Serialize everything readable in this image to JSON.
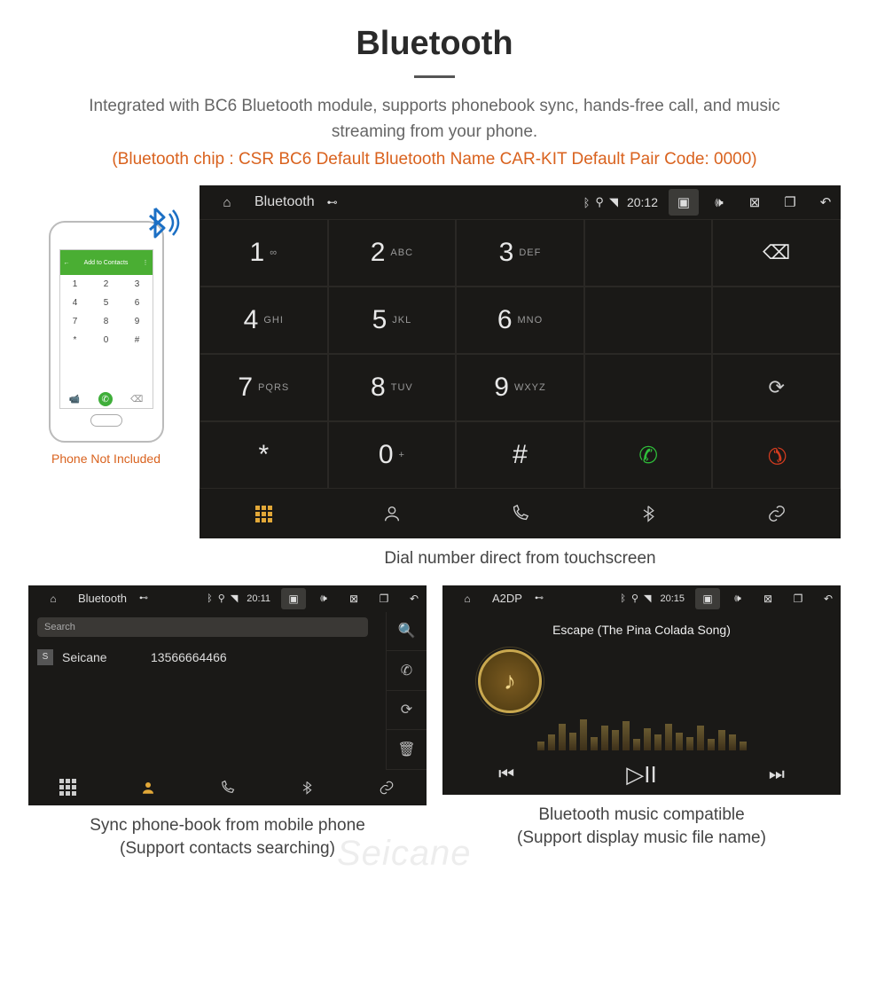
{
  "header": {
    "title": "Bluetooth",
    "desc": "Integrated with BC6 Bluetooth module, supports phonebook sync, hands-free call, and music streaming from your phone.",
    "spec": "(Bluetooth chip : CSR BC6     Default Bluetooth Name CAR-KIT     Default Pair Code: 0000)"
  },
  "phone": {
    "topbar": "Add to Contacts",
    "keys": [
      "1",
      "2",
      "3",
      "4",
      "5",
      "6",
      "7",
      "8",
      "9",
      "*",
      "0",
      "#"
    ],
    "note": "Phone Not Included"
  },
  "dialer": {
    "status": {
      "title": "Bluetooth",
      "time": "20:12"
    },
    "keys": [
      {
        "d": "1",
        "s": "∞"
      },
      {
        "d": "2",
        "s": "ABC"
      },
      {
        "d": "3",
        "s": "DEF"
      },
      {
        "d": "4",
        "s": "GHI"
      },
      {
        "d": "5",
        "s": "JKL"
      },
      {
        "d": "6",
        "s": "MNO"
      },
      {
        "d": "7",
        "s": "PQRS"
      },
      {
        "d": "8",
        "s": "TUV"
      },
      {
        "d": "9",
        "s": "WXYZ"
      },
      {
        "d": "*",
        "s": ""
      },
      {
        "d": "0",
        "s": "+"
      },
      {
        "d": "#",
        "s": ""
      }
    ],
    "caption": "Dial number direct from touchscreen"
  },
  "phonebook": {
    "status": {
      "title": "Bluetooth",
      "time": "20:11"
    },
    "search": "Search",
    "contact": {
      "initial": "S",
      "name": "Seicane",
      "number": "13566664466"
    },
    "caption1": "Sync phone-book from mobile phone",
    "caption2": "(Support contacts searching)"
  },
  "music": {
    "status": {
      "title": "A2DP",
      "time": "20:15"
    },
    "track": "Escape (The Pina Colada Song)",
    "caption1": "Bluetooth music compatible",
    "caption2": "(Support display music file name)"
  },
  "watermark": "Seicane"
}
